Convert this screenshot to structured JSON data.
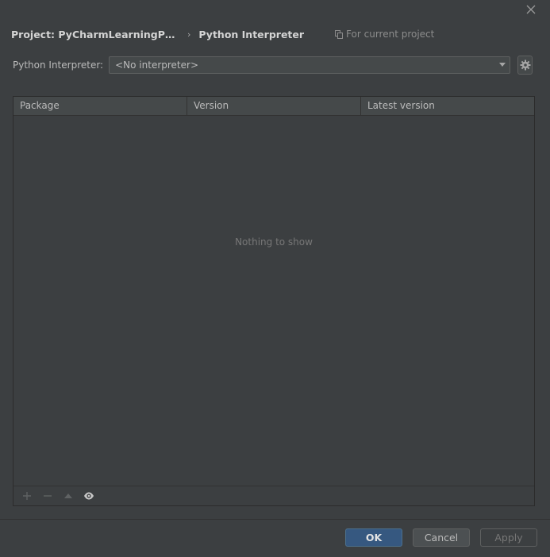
{
  "header": {
    "project_crumb": "Project: PyCharmLearningProjec...",
    "separator": "›",
    "page_title": "Python Interpreter",
    "scope_label": "For current project"
  },
  "interpreter": {
    "label": "Python Interpreter:",
    "selected": "<No interpreter>"
  },
  "table": {
    "columns": [
      "Package",
      "Version",
      "Latest version"
    ],
    "rows": [],
    "empty_text": "Nothing to show"
  },
  "toolbar": {
    "buttons": [
      "add-icon",
      "remove-icon",
      "upgrade-icon",
      "eye-icon"
    ]
  },
  "footer": {
    "ok_label": "OK",
    "cancel_label": "Cancel",
    "apply_label": "Apply"
  },
  "colors": {
    "background": "#3c3f41",
    "primary_button": "#365880",
    "text": "#bbbbbb",
    "muted_text": "#777777"
  }
}
